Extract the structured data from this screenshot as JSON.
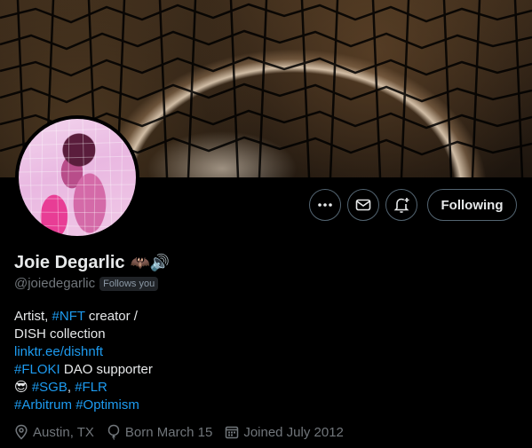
{
  "profile": {
    "display_name": "Joie Degarlic",
    "name_emojis": "🦇🔊",
    "handle": "@joiedegarlic",
    "follows_you": "Follows you"
  },
  "actions": {
    "more_icon": "more-icon",
    "message_icon": "mail-icon",
    "notify_icon": "notification-bell-icon",
    "following_label": "Following"
  },
  "bio": {
    "line1_a": "Artist, ",
    "line1_tag": "#NFT",
    "line1_b": " creator /",
    "line2": "DISH collection",
    "link": "linktr.ee/dishnft",
    "line4_tag": "#FLOKI",
    "line4_b": " DAO supporter",
    "line5_emoji": "😎",
    "line5_tag1": "#SGB",
    "line5_sep": ", ",
    "line5_tag2": "#FLR",
    "line6_tag1": "#Arbitrum",
    "line6_tag2": "#Optimism"
  },
  "meta": {
    "location": "Austin, TX",
    "born": "Born March 15",
    "joined": "Joined July 2012"
  },
  "colors": {
    "accent": "#1d9bf0",
    "muted": "#71767b",
    "text": "#e7e9ea",
    "background": "#000000"
  }
}
